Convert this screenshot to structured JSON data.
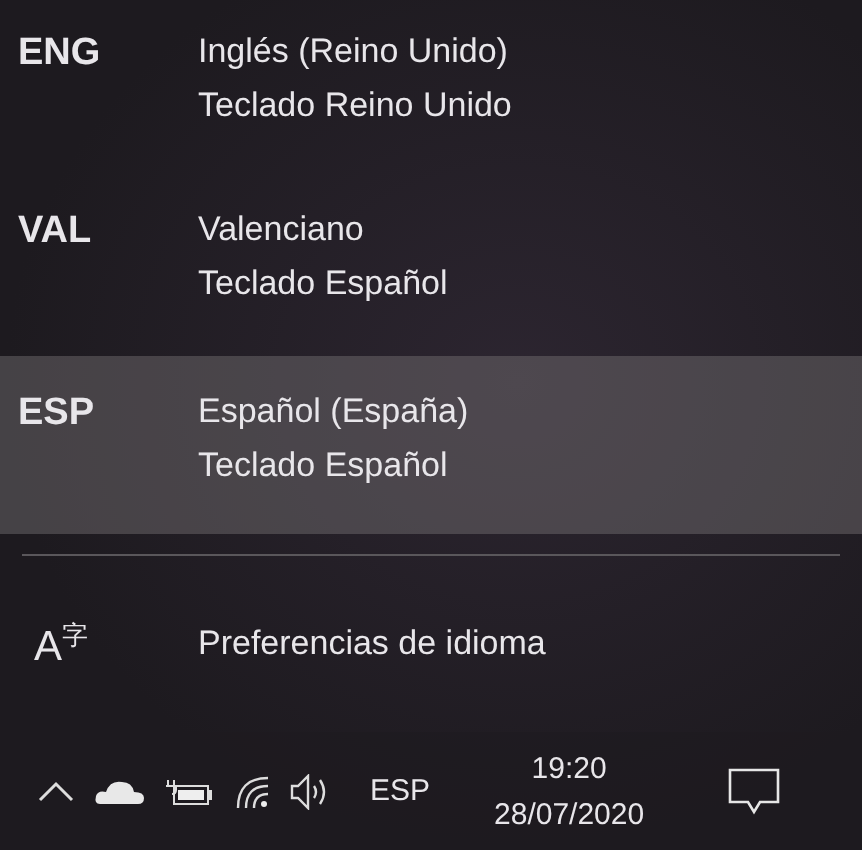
{
  "languages": [
    {
      "code": "ENG",
      "name": "Inglés (Reino Unido)",
      "keyboard": "Teclado Reino Unido",
      "selected": false
    },
    {
      "code": "VAL",
      "name": "Valenciano",
      "keyboard": "Teclado Español",
      "selected": false
    },
    {
      "code": "ESP",
      "name": "Español (España)",
      "keyboard": "Teclado Español",
      "selected": true
    }
  ],
  "preferences": {
    "icon": "A$^{字}$",
    "label": "Preferencias de idioma"
  },
  "taskbar": {
    "input_indicator": "ESP",
    "time": "19:20",
    "date": "28/07/2020"
  }
}
